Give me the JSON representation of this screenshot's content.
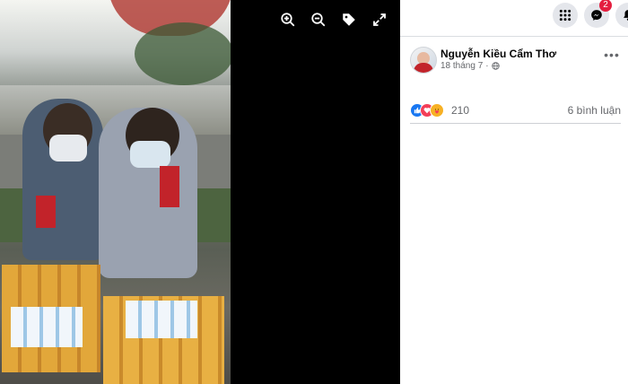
{
  "toolbar": {
    "zoom_in_icon": "zoom-in-icon",
    "zoom_out_icon": "zoom-out-icon",
    "tag_icon": "tag-icon",
    "fullscreen_icon": "fullscreen-icon"
  },
  "topbar": {
    "menu_icon": "grid-menu-icon",
    "messenger_icon": "messenger-icon",
    "messenger_badge": "2",
    "notifications_icon": "bell-icon"
  },
  "post": {
    "author": "Nguyễn Kiều Cẩm Thơ",
    "date": "18 tháng 7",
    "separator": "·",
    "privacy_icon": "globe-icon",
    "more_label": "•••",
    "reactions": {
      "icons": [
        "like",
        "love",
        "care"
      ],
      "count": "210"
    },
    "comments": "6 bình luận"
  },
  "colors": {
    "accent": "#1877f2",
    "badge": "#e41e3f",
    "secondary_text": "#65676b"
  }
}
